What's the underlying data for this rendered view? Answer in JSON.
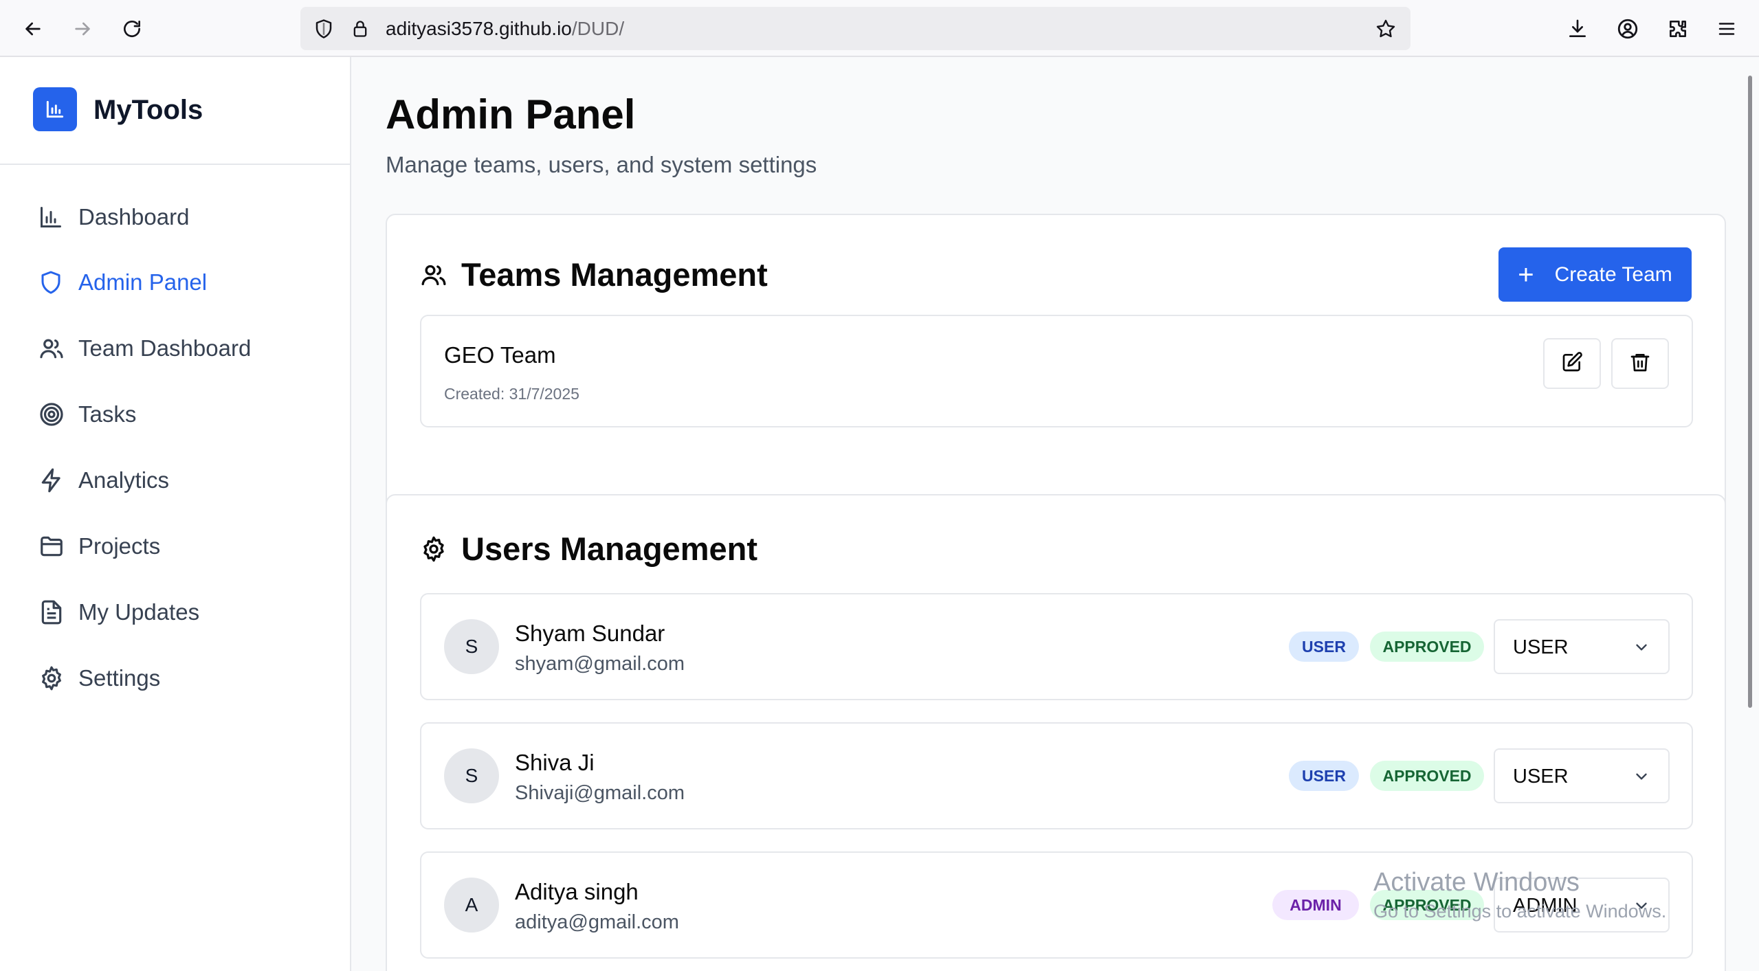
{
  "browser": {
    "url_host": "adityasi3578.github.io",
    "url_path": "/DUD/"
  },
  "sidebar": {
    "brand": "MyTools",
    "items": [
      {
        "label": "Dashboard",
        "icon": "bar-chart-icon",
        "active": false
      },
      {
        "label": "Admin Panel",
        "icon": "shield-icon",
        "active": true
      },
      {
        "label": "Team Dashboard",
        "icon": "users-icon",
        "active": false
      },
      {
        "label": "Tasks",
        "icon": "target-icon",
        "active": false
      },
      {
        "label": "Analytics",
        "icon": "lightning-icon",
        "active": false
      },
      {
        "label": "Projects",
        "icon": "folder-icon",
        "active": false
      },
      {
        "label": "My Updates",
        "icon": "document-icon",
        "active": false
      },
      {
        "label": "Settings",
        "icon": "gear-icon",
        "active": false
      }
    ]
  },
  "header": {
    "title": "Admin Panel",
    "subtitle": "Manage teams, users, and system settings"
  },
  "teams": {
    "title": "Teams Management",
    "create_label": "Create Team",
    "items": [
      {
        "name": "GEO Team",
        "created": "Created: 31/7/2025"
      }
    ]
  },
  "users": {
    "title": "Users Management",
    "items": [
      {
        "initial": "S",
        "name": "Shyam Sundar",
        "email": "shyam@gmail.com",
        "role_badge": "USER",
        "status": "APPROVED",
        "role_select": "USER"
      },
      {
        "initial": "S",
        "name": "Shiva Ji",
        "email": "Shivaji@gmail.com",
        "role_badge": "USER",
        "status": "APPROVED",
        "role_select": "USER"
      },
      {
        "initial": "A",
        "name": "Aditya singh",
        "email": "aditya@gmail.com",
        "role_badge": "ADMIN",
        "status": "APPROVED",
        "role_select": "ADMIN"
      }
    ]
  },
  "watermark": {
    "line1": "Activate Windows",
    "line2": "Go to Settings to activate Windows."
  },
  "colors": {
    "accent": "#2563eb",
    "user_badge_bg": "#dbeafe",
    "admin_badge_bg": "#f3e8ff",
    "approved_badge_bg": "#dcfce7"
  }
}
